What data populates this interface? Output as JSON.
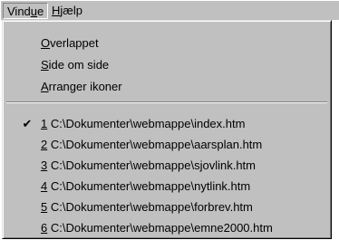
{
  "menubar": {
    "items": [
      {
        "label": "Vindue",
        "mnemonic_index": 4
      },
      {
        "label": "Hjælp",
        "mnemonic_index": 0
      }
    ]
  },
  "window_menu": {
    "arrange_items": [
      {
        "label": "Overlappet",
        "mnemonic_index": 0
      },
      {
        "label": "Side om side",
        "mnemonic_index": 0
      },
      {
        "label": "Arranger ikoner",
        "mnemonic_index": 0
      }
    ],
    "documents": [
      {
        "number": "1",
        "path": "C:\\Dokumenter\\webmappe\\index.htm",
        "checked": true
      },
      {
        "number": "2",
        "path": "C:\\Dokumenter\\webmappe\\aarsplan.htm",
        "checked": false
      },
      {
        "number": "3",
        "path": "C:\\Dokumenter\\webmappe\\sjovlink.htm",
        "checked": false
      },
      {
        "number": "4",
        "path": "C:\\Dokumenter\\webmappe\\nytlink.htm",
        "checked": false
      },
      {
        "number": "5",
        "path": "C:\\Dokumenter\\webmappe\\forbrev.htm",
        "checked": false
      },
      {
        "number": "6",
        "path": "C:\\Dokumenter\\webmappe\\emne2000.htm",
        "checked": false
      }
    ],
    "check_glyph": "✔"
  },
  "colors": {
    "menu_face": "#c0c0c0",
    "highlight": "#ffffff",
    "shadow": "#808080"
  }
}
